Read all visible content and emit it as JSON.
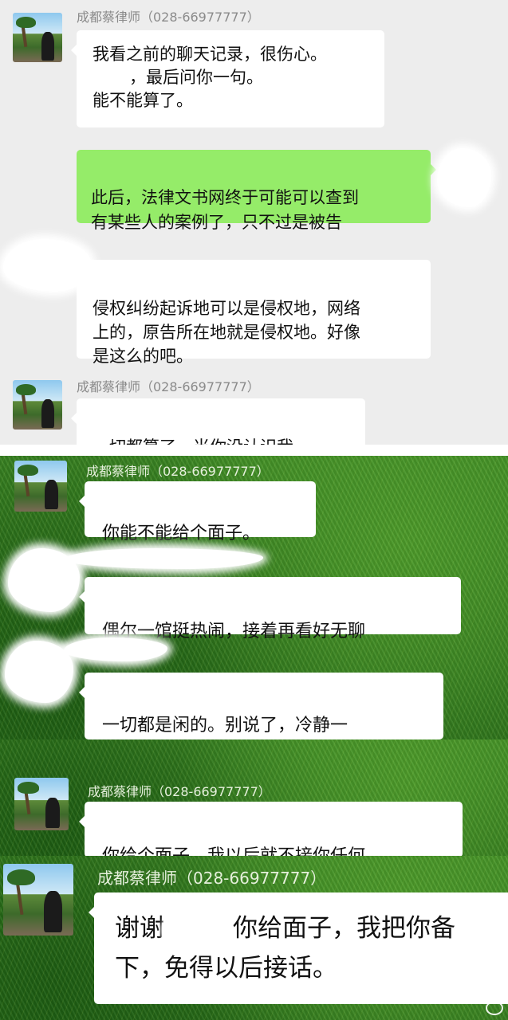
{
  "contact": {
    "name": "成都蔡律师（028-66977777）"
  },
  "panel1": {
    "messages": [
      {
        "line1": "我看之前的聊天记录，很伤心。",
        "line2": "，最后问你一句。",
        "line3": "能不能算了。"
      },
      {
        "text": "此后，法律文书网终于可能可以查到\n有某些人的案例了，只不过是被告"
      },
      {
        "text": "侵权纠纷起诉地可以是侵权地，网络\n上的，原告所在地就是侵权地。好像\n是这么的吧。"
      },
      {
        "text": "一切都算了，当你没认识我。"
      }
    ]
  },
  "panel2": {
    "messages": [
      {
        "text": "你能不能给个面子。"
      },
      {
        "text": "偶尔一馆挺热闹，接着再看好无聊"
      },
      {
        "text": "一切都是闲的。别说了，冷静一\n下，其实也没多大事。"
      }
    ]
  },
  "panel3": {
    "messages": [
      {
        "text": "你给个面子，我以后就不接你任何"
      }
    ]
  },
  "panel4": {
    "messages": [
      {
        "part1": "谢谢",
        "part2": "你给面子，我把你备",
        "line2": "下，免得以后接话。"
      }
    ]
  },
  "colors": {
    "sent_bubble": "#95ec69",
    "received_bubble": "#ffffff",
    "chat_background": "#ededed",
    "grass_background": "#2f7a1e"
  },
  "icons": [
    "avatar-beach-photo",
    "watermark-logo-icon"
  ]
}
